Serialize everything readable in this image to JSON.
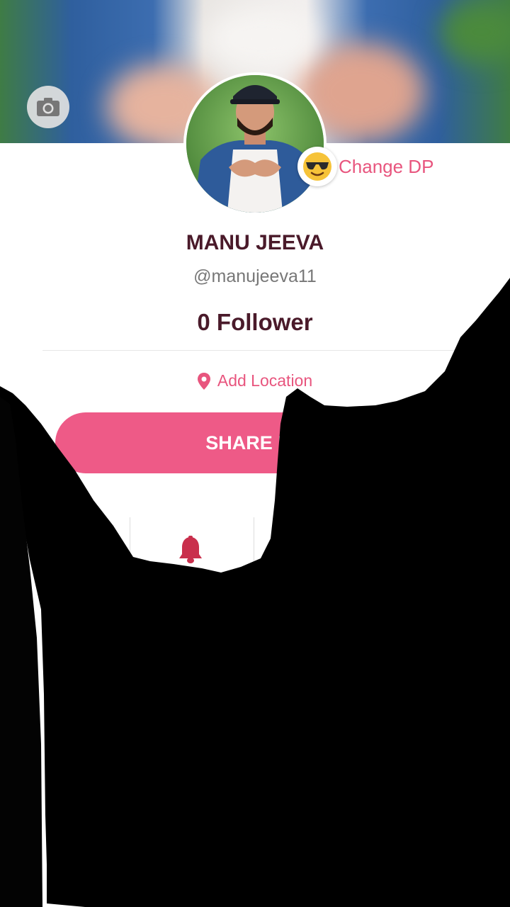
{
  "profile": {
    "name": "MANU JEEVA",
    "handle": "@manujeeva11",
    "followers": "0 Follower",
    "location_label": "Add Location",
    "change_dp_label": "Change DP",
    "share_button_label": "SHARE PR"
  },
  "colors": {
    "accent": "#e8557e",
    "button": "#ee5a87",
    "name_text": "#4a1a2a"
  },
  "icons": {
    "camera": "camera-icon",
    "location": "location-pin-icon",
    "emoji": "sunglasses-emoji-icon",
    "bell": "bell-icon"
  }
}
